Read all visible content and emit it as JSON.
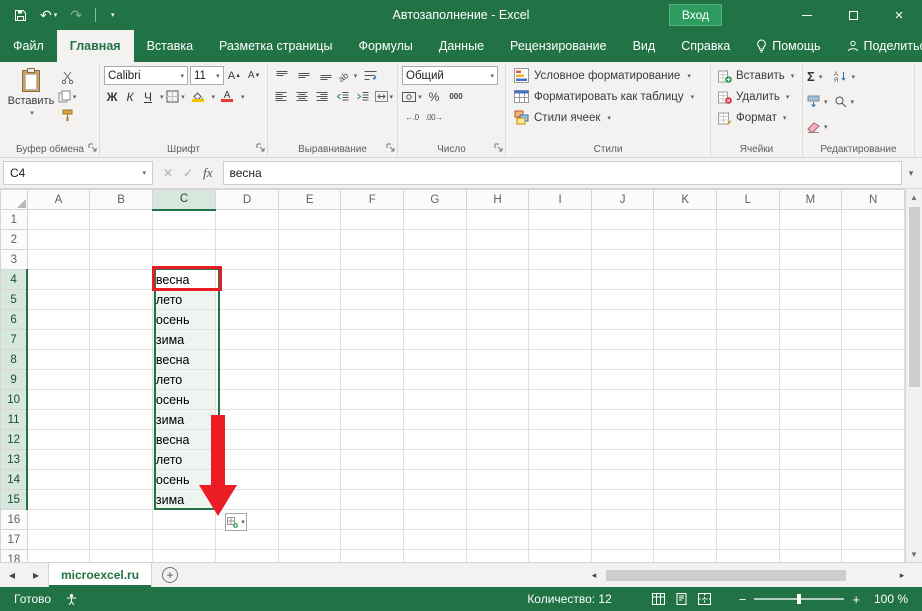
{
  "colors": {
    "excel_green": "#217346",
    "annotation_red": "#ec1c24",
    "sign_in_green": "#2d9c5e",
    "selection_fill": "#eef4f0"
  },
  "titlebar": {
    "title": "Автозаполнение - Excel",
    "sign_in_label": "Вход"
  },
  "tabs": {
    "file": "Файл",
    "items": [
      "Главная",
      "Вставка",
      "Разметка страницы",
      "Формулы",
      "Данные",
      "Рецензирование",
      "Вид",
      "Справка"
    ],
    "active": "Главная",
    "help": "Помощь",
    "share": "Поделиться"
  },
  "ribbon": {
    "clipboard": {
      "paste": "Вставить",
      "label": "Буфер обмена"
    },
    "font": {
      "name": "Calibri",
      "size": "11",
      "bold": "Ж",
      "italic": "К",
      "underline": "Ч",
      "label": "Шрифт"
    },
    "alignment": {
      "label": "Выравнивание"
    },
    "number": {
      "format": "Общий",
      "label": "Число"
    },
    "styles": {
      "conditional": "Условное форматирование",
      "format_table": "Форматировать как таблицу",
      "cell_styles": "Стили ячеек",
      "label": "Стили"
    },
    "cells": {
      "insert": "Вставить",
      "delete": "Удалить",
      "format": "Формат",
      "label": "Ячейки"
    },
    "editing": {
      "label": "Редактирование"
    }
  },
  "formula_bar": {
    "name_box": "C4",
    "fx": "fx",
    "value": "весна"
  },
  "grid": {
    "columns": [
      "A",
      "B",
      "C",
      "D",
      "E",
      "F",
      "G",
      "H",
      "I",
      "J",
      "K",
      "L",
      "M",
      "N"
    ],
    "row_count": 18,
    "selected_column": "C",
    "selected_rows_start": 4,
    "selected_rows_end": 15,
    "fill_start_row": 4,
    "fill_values": [
      "весна",
      "лето",
      "осень",
      "зима",
      "весна",
      "лето",
      "осень",
      "зима",
      "весна",
      "лето",
      "осень",
      "зима"
    ]
  },
  "sheet_bar": {
    "tab": "microexcel.ru",
    "new_sheet": "+"
  },
  "status_bar": {
    "ready": "Готово",
    "count": "Количество: 12",
    "zoom": "100 %"
  }
}
